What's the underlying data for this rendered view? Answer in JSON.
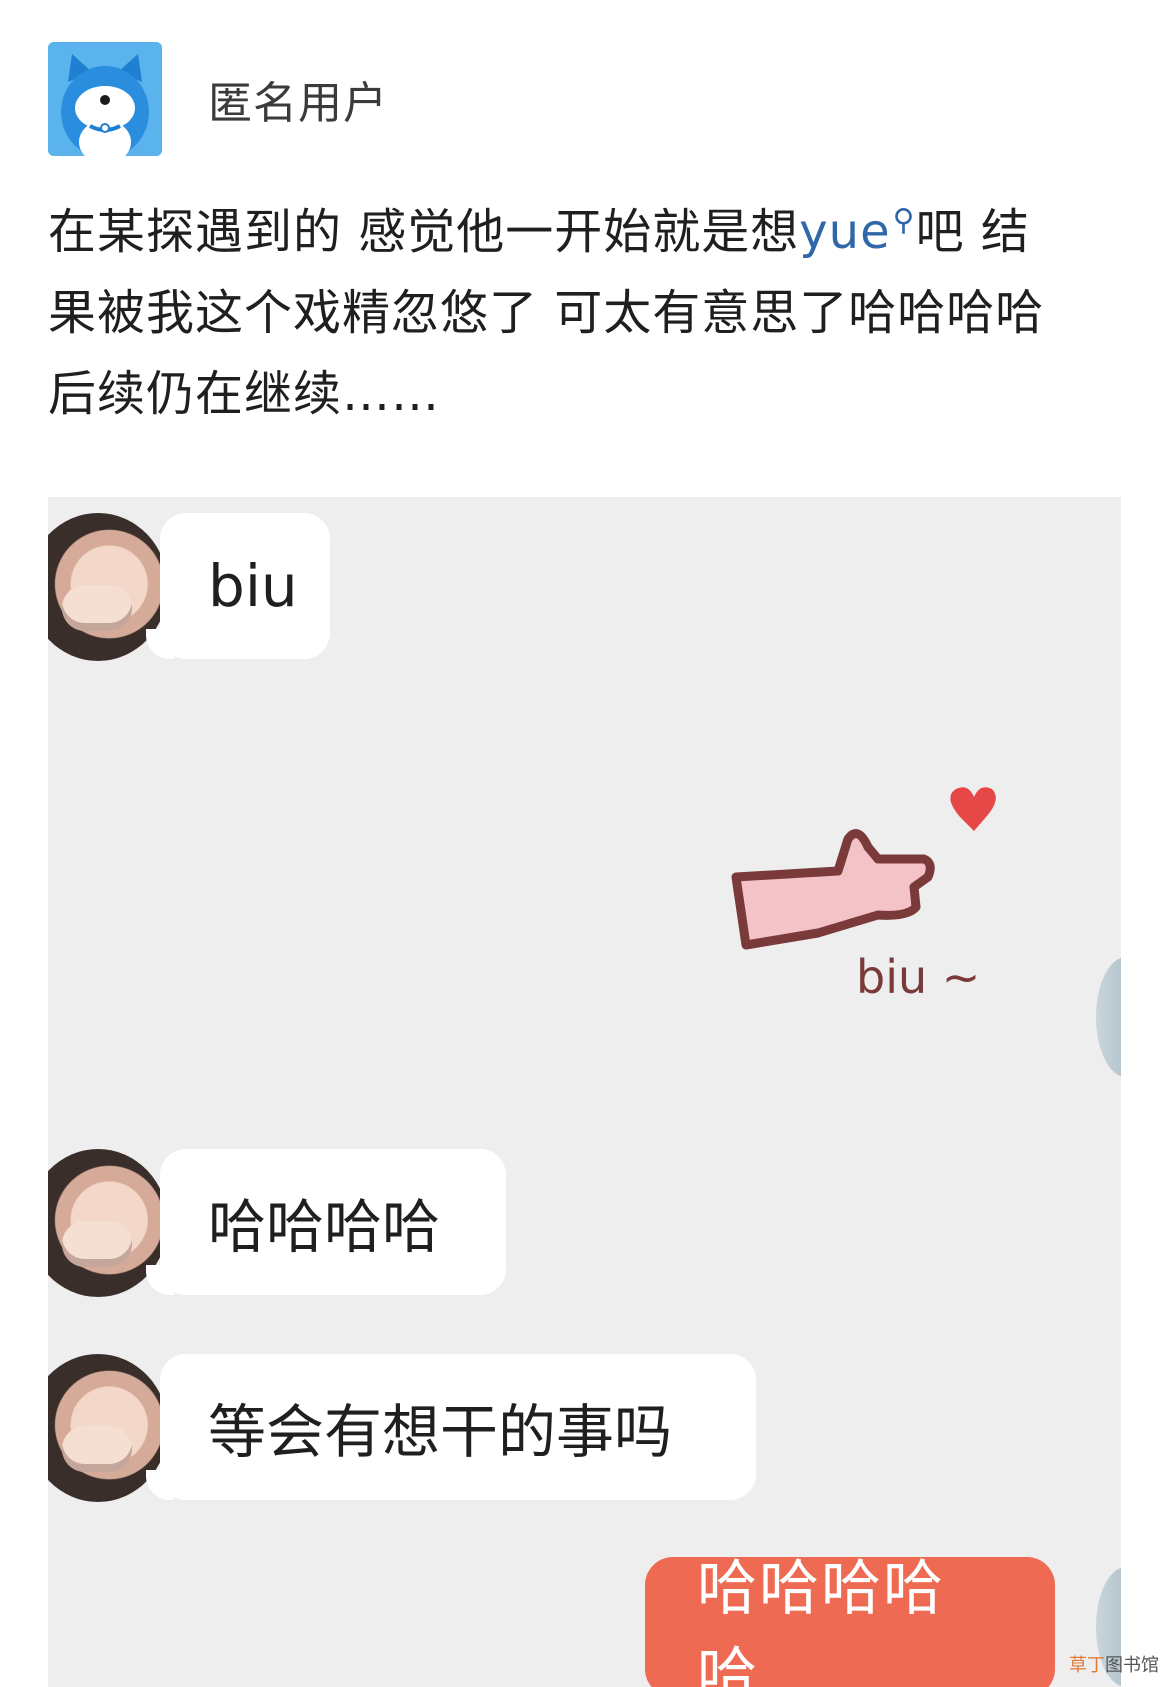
{
  "post": {
    "username": "匿名用户",
    "text_before_link": "在某探遇到的 感觉他一开始就是想",
    "link_text": "yue",
    "link_icon": "search-icon",
    "text_after_link_line1": "吧 结",
    "line2": "果被我这个戏精忽悠了 可太有意思了哈哈哈哈",
    "line3": "后续仍在继续……"
  },
  "chat": {
    "messages": [
      {
        "side": "left",
        "text": "biu"
      },
      {
        "side": "right",
        "type": "sticker",
        "sticker_text": "biu ~"
      },
      {
        "side": "left",
        "text": "哈哈哈哈"
      },
      {
        "side": "left",
        "text": "等会有想干的事吗"
      },
      {
        "side": "right",
        "text": "哈哈哈哈哈"
      }
    ],
    "bubble_color_right": "#ef6a53",
    "background": "#eeeeee"
  },
  "watermark": {
    "accent": "草丁",
    "rest": "图书馆"
  }
}
